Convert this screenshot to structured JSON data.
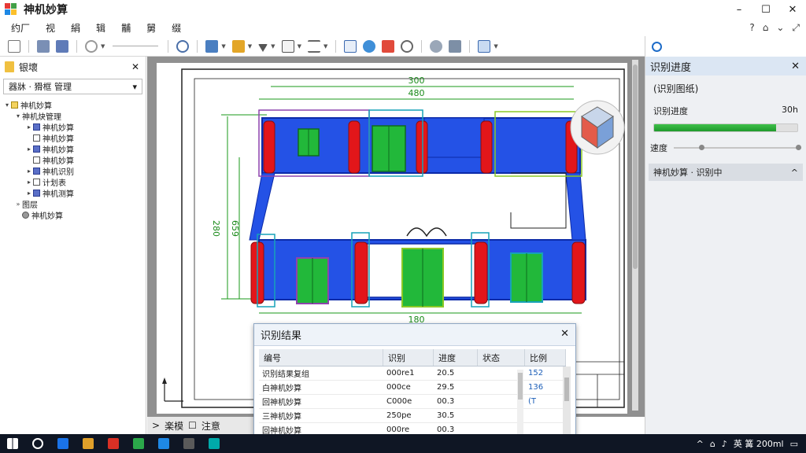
{
  "app": {
    "title": "神机妙算"
  },
  "window_controls": {
    "minimize": "–",
    "maximize": "☐",
    "close": "✕"
  },
  "menu": {
    "items": [
      "约厂",
      "视",
      "絹",
      "辑",
      "黼",
      "舅",
      "缀"
    ]
  },
  "menu_right": {
    "help": "?",
    "nav": "⌂",
    "caret": "⌄",
    "expand": "⤢"
  },
  "left_panel": {
    "title": "银壞",
    "close": "✕",
    "dropdown_value": "器牀 · 猾框 管理",
    "tree": [
      {
        "label": "神机妙算",
        "indent": 0,
        "exp": "▾",
        "box": "yellow"
      },
      {
        "label": "神机炔管理",
        "indent": 1,
        "exp": "▾",
        "box": "none"
      },
      {
        "label": "神机妙算",
        "indent": 2,
        "exp": "▸",
        "box": "filled"
      },
      {
        "label": "神机妙算",
        "indent": 2,
        "exp": "",
        "box": "empty"
      },
      {
        "label": "神机妙算",
        "indent": 2,
        "exp": "▸",
        "box": "filled"
      },
      {
        "label": "神机妙算",
        "indent": 2,
        "exp": "",
        "box": "empty"
      },
      {
        "label": "神机识别",
        "indent": 2,
        "exp": "▸",
        "box": "filled"
      },
      {
        "label": "计划表",
        "indent": 2,
        "exp": "▸",
        "box": "empty"
      },
      {
        "label": "神机测算",
        "indent": 2,
        "exp": "▸",
        "box": "filled"
      },
      {
        "label": "图层",
        "indent": 1,
        "exp": "»",
        "box": "none"
      },
      {
        "label": "神机妙算",
        "indent": 1,
        "exp": "",
        "box": "gear"
      }
    ]
  },
  "drawing": {
    "dims": {
      "top1": "300",
      "top2": "480",
      "left1": "280",
      "left2": "659",
      "bottom": "180"
    }
  },
  "canvas_status": {
    "model_tab": "楽模",
    "layout_tab": "注意"
  },
  "right_panel": {
    "title": "识别进度",
    "close": "✕",
    "subtitle": "(识别图纸)",
    "progress_label": "识别进度",
    "progress_value_text": "30h",
    "progress_fraction": 0.85,
    "slider_label": "速度",
    "slider_fraction": 0.2,
    "section_label": "神机妙算 · 识别中",
    "section_caret": "^"
  },
  "results_dialog": {
    "title": "识别结果",
    "close": "✕",
    "columns": [
      "编号",
      "识别",
      "进度",
      "状态",
      "比例"
    ],
    "rows": [
      {
        "name": "识别结果复组",
        "code": "000re1",
        "val": "20.5",
        "status": "",
        "ratio": "152"
      },
      {
        "name": "白神机妙算",
        "code": "000ce",
        "val": "29.5",
        "status": "",
        "ratio": "136"
      },
      {
        "name": "回神机妙算",
        "code": "C000e",
        "val": "00.3",
        "status": "",
        "ratio": "(T"
      },
      {
        "name": "三神机妙算",
        "code": "250pe",
        "val": "30.5",
        "status": "",
        "ratio": ""
      },
      {
        "name": "回神机妙算",
        "code": "000re",
        "val": "00.3",
        "status": "",
        "ratio": ""
      }
    ]
  },
  "taskbar": {
    "tray_text": "英 篝 200ml",
    "colors": [
      "#1a73e8",
      "#e0a02a",
      "#d93025",
      "#2ba84a",
      "#1e88e5",
      "#5a5a5a",
      "#0aa"
    ]
  }
}
